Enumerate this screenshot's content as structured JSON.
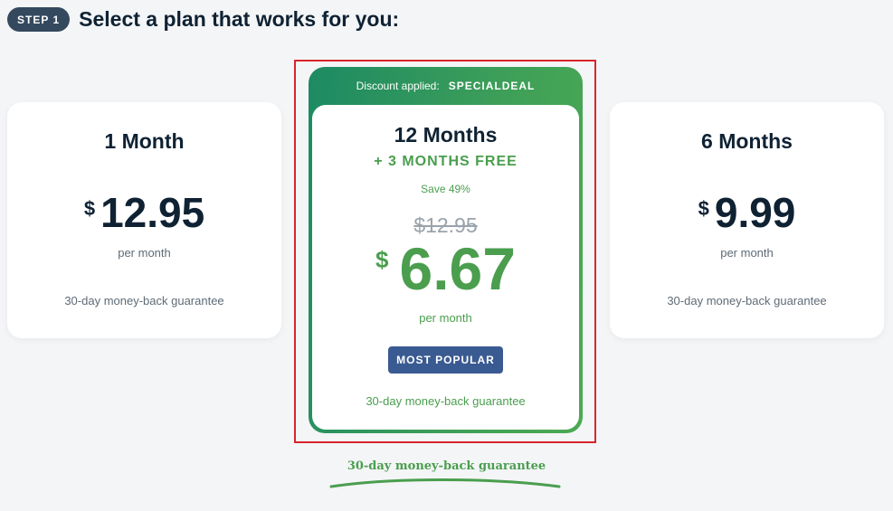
{
  "header": {
    "step_badge": "STEP 1",
    "title": "Select a plan that works for you:"
  },
  "plans": [
    {
      "title": "1 Month",
      "currency": "$",
      "price": "12.95",
      "per": "per month",
      "guarantee": "30-day money-back guarantee"
    },
    {
      "discount_label": "Discount applied:",
      "discount_code": "SPECIALDEAL",
      "title": "12 Months",
      "bonus": "+ 3 MONTHS FREE",
      "save": "Save 49%",
      "old_price": "$12.95",
      "currency": "$",
      "price": "6.67",
      "per": "per month",
      "badge": "MOST POPULAR",
      "guarantee": "30-day money-back guarantee"
    },
    {
      "title": "6 Months",
      "currency": "$",
      "price": "9.99",
      "per": "per month",
      "guarantee": "30-day money-back guarantee"
    }
  ],
  "footer": {
    "guarantee": "30-day money-back guarantee"
  },
  "colors": {
    "accent_green": "#4a9e4e",
    "badge_blue": "#3a5a92",
    "highlight_red": "#d7262d",
    "step_badge": "#34495e"
  }
}
